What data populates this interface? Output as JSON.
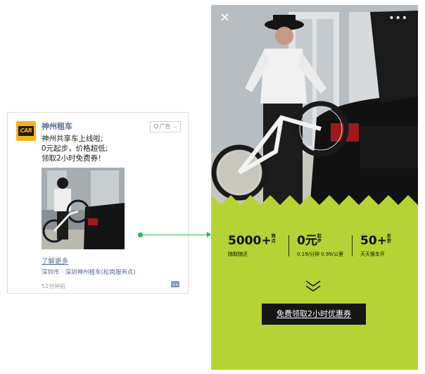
{
  "ad": {
    "brand_logo_text": "CAR",
    "brand_name": "神州租车",
    "ad_tag": "广告",
    "text_lines": [
      "神州共享车上线啦;",
      "0元起步，价格超低;",
      "领取2小时免费券！"
    ],
    "learn_more": "了解更多",
    "location": "深圳市 · 深圳神州租车(松岗服务点)",
    "time": "51分钟前"
  },
  "landing": {
    "stats": [
      {
        "value": "5000+",
        "suffix": "网点",
        "sub": "随取随还"
      },
      {
        "value": "0元",
        "suffix": "起步",
        "sub": "0.19/分钟 0.99/公里"
      },
      {
        "value": "50+",
        "suffix": "车型",
        "sub": "天天换车开"
      }
    ],
    "cta_label": "免费领取2小时优惠券"
  },
  "colors": {
    "accent_green": "#b5d334",
    "link_blue": "#576b95",
    "connector": "#2db84c",
    "brand_yellow": "#f6b31b"
  },
  "icons": [
    "location-pin-icon",
    "comment-icon",
    "close-icon",
    "more-icon",
    "double-chevron-down-icon"
  ]
}
